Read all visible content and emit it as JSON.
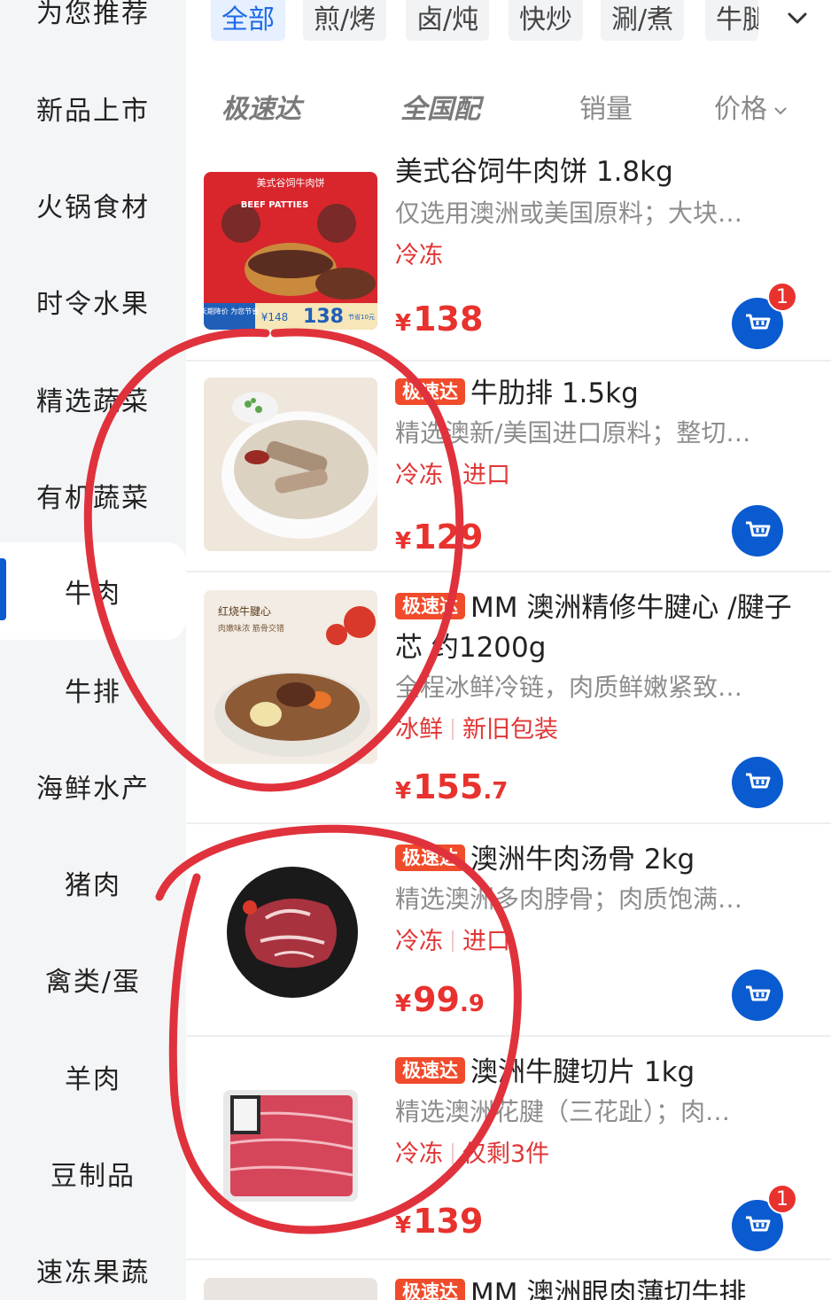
{
  "sidebar": {
    "items": [
      {
        "label": "为您推荐"
      },
      {
        "label": "新品上市"
      },
      {
        "label": "火锅食材"
      },
      {
        "label": "时令水果"
      },
      {
        "label": "精选蔬菜"
      },
      {
        "label": "有机蔬菜"
      },
      {
        "label": "牛肉"
      },
      {
        "label": "牛排"
      },
      {
        "label": "海鲜水产"
      },
      {
        "label": "猪肉"
      },
      {
        "label": "禽类/蛋"
      },
      {
        "label": "羊肉"
      },
      {
        "label": "豆制品"
      },
      {
        "label": "速冻果蔬"
      }
    ],
    "active_index": 6
  },
  "chips": {
    "items": [
      {
        "label": "全部"
      },
      {
        "label": "煎/烤"
      },
      {
        "label": "卤/炖"
      },
      {
        "label": "快炒"
      },
      {
        "label": "涮/煮"
      },
      {
        "label": "牛腿"
      }
    ],
    "active_index": 0,
    "expand_icon": "chevron-down-icon"
  },
  "sortbar": {
    "fast": "极速达",
    "national": "全国配",
    "sales": "销量",
    "price": "价格"
  },
  "products": [
    {
      "fast_tag": "",
      "title": "美式谷饲牛肉饼 1.8kg",
      "desc": "仅选用澳洲或美国原料；大块…",
      "tags": [
        "冷冻"
      ],
      "price_int": "138",
      "price_dec": "",
      "cart_badge": "1",
      "image_text": {
        "top": "美式谷饲牛肉饼",
        "brand": "BEEF PATTIES",
        "promo_left": "长期降价 为您节省",
        "promo_old": "¥148",
        "promo_new": "138",
        "promo_save": "节省10元"
      }
    },
    {
      "fast_tag": "极速达",
      "title": "牛肋排 1.5kg",
      "desc": "精选澳新/美国进口原料；整切…",
      "tags": [
        "冷冻",
        "进口"
      ],
      "price_int": "129",
      "price_dec": "",
      "cart_badge": ""
    },
    {
      "fast_tag": "极速达",
      "title": "MM 澳洲精修牛腱心 /腱子芯 约1200g",
      "desc": "全程冰鲜冷链，肉质鲜嫩紧致…",
      "tags": [
        "冰鲜",
        "新旧包装"
      ],
      "price_int": "155",
      "price_dec": ".7",
      "cart_badge": "",
      "image_text": {
        "line1": "红烧牛腱心",
        "line2": "肉嫩味浓 筋骨交错"
      }
    },
    {
      "fast_tag": "极速达",
      "title": "澳洲牛肉汤骨 2kg",
      "desc": "精选澳洲多肉脖骨；肉质饱满…",
      "tags": [
        "冷冻",
        "进口"
      ],
      "price_int": "99",
      "price_dec": ".9",
      "cart_badge": ""
    },
    {
      "fast_tag": "极速达",
      "title": "澳洲牛腱切片 1kg",
      "desc": "精选澳洲花腱（三花趾）；肉…",
      "tags": [
        "冷冻",
        "仅剩3件"
      ],
      "price_int": "139",
      "price_dec": "",
      "cart_badge": "1"
    },
    {
      "fast_tag": "极速达",
      "title": "MM 澳洲眼肉薄切牛排",
      "desc": "",
      "tags": [],
      "price_int": "",
      "price_dec": "",
      "cart_badge": ""
    }
  ],
  "currency": "¥",
  "colors": {
    "accent_blue": "#0a5bd0",
    "price_red": "#e8322e",
    "fast_tag_bg": "#f04b2a",
    "annotation_red": "#e0323c"
  }
}
